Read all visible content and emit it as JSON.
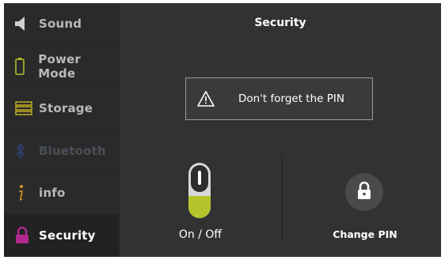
{
  "sidebar": {
    "items": [
      {
        "label": "Sound",
        "icon": "speaker-icon"
      },
      {
        "label": "Power Mode",
        "icon": "battery-icon"
      },
      {
        "label": "Storage",
        "icon": "storage-icon"
      },
      {
        "label": "Bluetooth",
        "icon": "bluetooth-icon"
      },
      {
        "label": "info",
        "icon": "info-icon"
      },
      {
        "label": "Security",
        "icon": "lock-icon",
        "active": true
      }
    ]
  },
  "main": {
    "title": "Security",
    "warning": {
      "text": "Don't forget the PIN",
      "icon": "warning-icon"
    },
    "toggle": {
      "label": "On / Off",
      "state": "on"
    },
    "change_pin": {
      "label": "Change PIN",
      "icon": "lock-icon"
    }
  },
  "colors": {
    "accent_green": "#b5c42a",
    "security_purple": "#b0288d",
    "background": "#323232"
  }
}
